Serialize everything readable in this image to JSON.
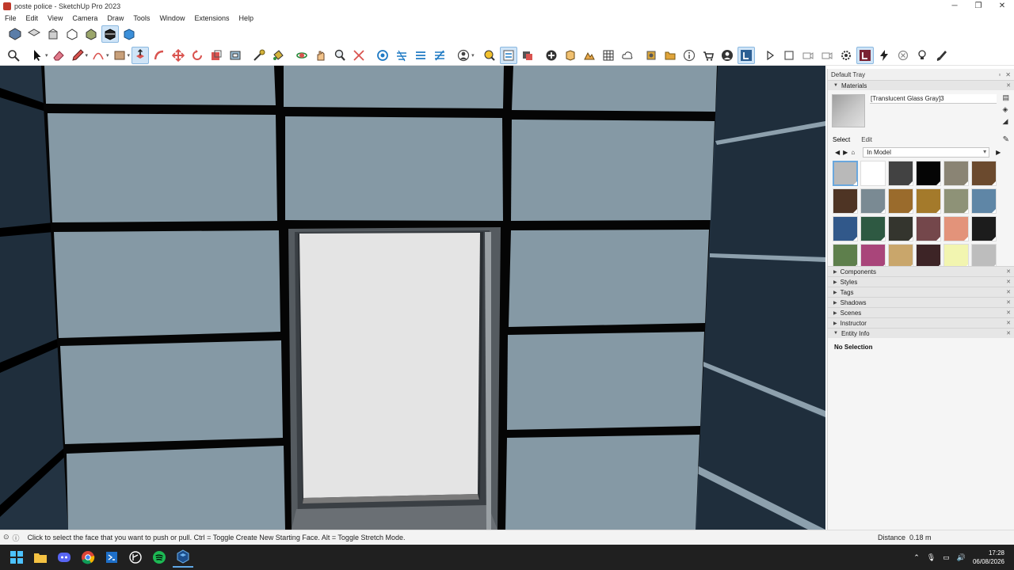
{
  "window": {
    "title": "poste police - SketchUp Pro 2023",
    "minimize_icon": "minimize-icon",
    "maximize_icon": "restore-icon",
    "close_icon": "close-icon"
  },
  "menu": [
    "File",
    "Edit",
    "View",
    "Camera",
    "Draw",
    "Tools",
    "Window",
    "Extensions",
    "Help"
  ],
  "toolbar_views": [
    "iso-view-icon",
    "top-view-icon",
    "front-view-icon",
    "right-view-icon",
    "back-view-icon",
    "left-view-icon",
    "bottom-view-icon"
  ],
  "toolbar_tools": [
    "search-icon",
    "select-icon",
    "eraser-icon",
    "pencil-icon",
    "arc-icon",
    "rectangle-icon",
    "push-pull-icon",
    "follow-me-icon",
    "move-icon",
    "rotate-icon",
    "scale-icon",
    "offset-icon",
    "tape-measure-icon",
    "paint-bucket-icon",
    "orbit-icon",
    "pan-icon",
    "zoom-icon",
    "zoom-extents-icon",
    "section-plane-icon",
    "layout-icon",
    "warehouse-icon",
    "account-icon",
    "play-icon",
    "settings-icon",
    "flash-icon",
    "bulb-icon",
    "brush-icon"
  ],
  "tray": {
    "title": "Default Tray",
    "materials_panel": "Materials",
    "material_name": "[Translucent Glass Gray]3",
    "tab_select": "Select",
    "tab_edit": "Edit",
    "library": "In Model",
    "swatch_colors": [
      "#b9b9b9",
      "#ffffff",
      "#424242",
      "#050505",
      "#8a8474",
      "#6b4a2e",
      "#4e3424",
      "#7a8a93",
      "#9a6b2c",
      "#a47a2b",
      "#8e9277",
      "#5f86a6",
      "#31588a",
      "#2e5942",
      "#34352e",
      "#74474b",
      "#e3937a",
      "#1c1c1c",
      "#5e7f4c",
      "#a9457a",
      "#c9a66b",
      "#3d2426",
      "#f2f5b0",
      "#bdbdbd"
    ],
    "panels": [
      "Components",
      "Styles",
      "Tags",
      "Shadows",
      "Scenes",
      "Instructor",
      "Entity Info"
    ],
    "entity_info_text": "No Selection"
  },
  "status": {
    "message": "Click to select the face that you want to push or pull.  Ctrl = Toggle Create New Starting Face.  Alt = Toggle Stretch Mode.",
    "measure_label": "Distance",
    "measure_value": "0.18 m"
  },
  "taskbar": {
    "apps": [
      "windows-start-icon",
      "file-explorer-icon",
      "discord-icon",
      "chrome-icon",
      "visual-studio-icon",
      "git-icon",
      "spotify-icon",
      "sketchup-icon"
    ],
    "time": "17:28",
    "date": "06/08/2026"
  }
}
